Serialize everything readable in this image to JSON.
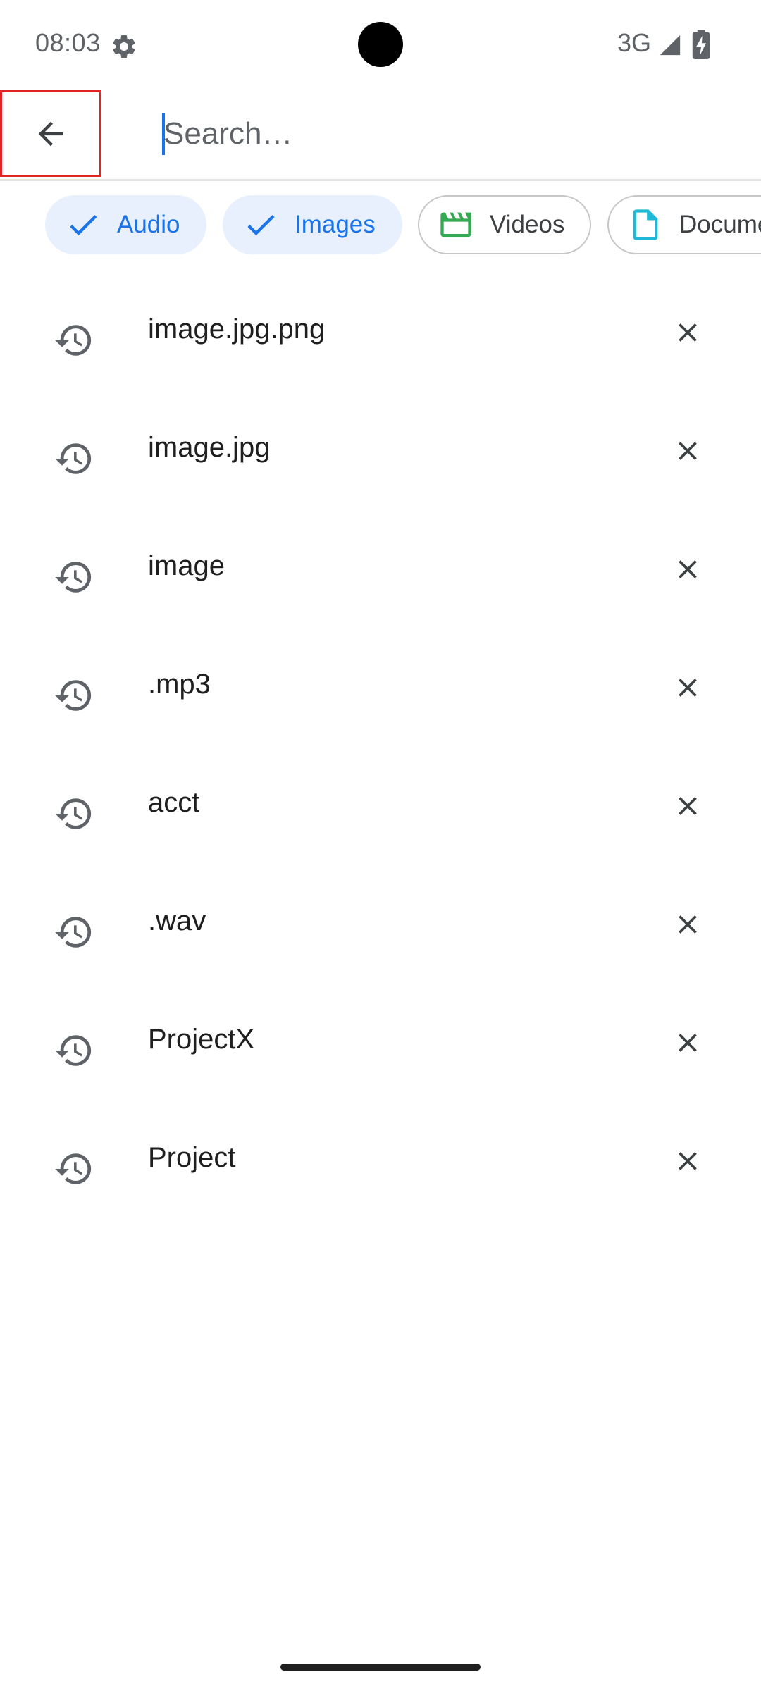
{
  "status_bar": {
    "time": "08:03",
    "network": "3G",
    "icons": [
      "settings-gear-icon",
      "cell-signal-icon",
      "battery-charging-icon"
    ]
  },
  "search": {
    "placeholder": "Search…",
    "value": "",
    "back_icon": "arrow-left-icon"
  },
  "colors": {
    "accent": "#1a73e8",
    "chip_selected_bg": "#e8f0fe",
    "videos_icon": "#34a853",
    "documents_icon": "#1fb8d6",
    "highlight_box": "#e02424"
  },
  "chips": [
    {
      "label": "Audio",
      "selected": true,
      "icon": "check-icon"
    },
    {
      "label": "Images",
      "selected": true,
      "icon": "check-icon"
    },
    {
      "label": "Videos",
      "selected": false,
      "icon": "movie-clapper-icon"
    },
    {
      "label": "Documents",
      "selected": false,
      "icon": "document-icon"
    }
  ],
  "history": [
    {
      "text": "image.jpg.png"
    },
    {
      "text": "image.jpg"
    },
    {
      "text": "image"
    },
    {
      "text": ".mp3"
    },
    {
      "text": "acct"
    },
    {
      "text": ".wav"
    },
    {
      "text": "ProjectX"
    },
    {
      "text": "Project"
    }
  ]
}
